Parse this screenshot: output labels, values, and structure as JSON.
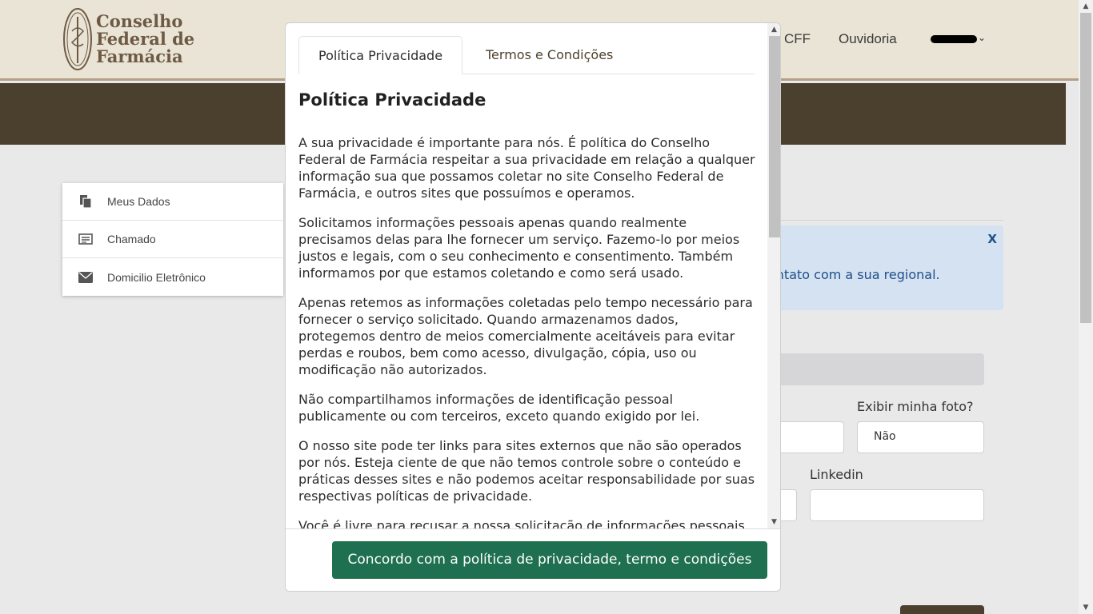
{
  "header": {
    "logo": {
      "line1": "Conselho",
      "line2": "Federal de",
      "line3": "Farmácia"
    },
    "nav": {
      "cff": "CFF",
      "ouvidoria": "Ouvidoria"
    }
  },
  "sidebar": {
    "items": [
      {
        "label": "Meus Dados",
        "icon": "documents-icon"
      },
      {
        "label": "Chamado",
        "icon": "card-list-icon"
      },
      {
        "label": "Domicilio Eletrônico",
        "icon": "envelope-icon"
      }
    ]
  },
  "page": {
    "alert_text": "ontato com a sua regional.",
    "alert_close": "X",
    "label_foto": "Exibir minha foto?",
    "foto_value": "Não",
    "label_linkedin": "Linkedin"
  },
  "modal": {
    "tabs": [
      {
        "label": "Política Privacidade"
      },
      {
        "label": "Termos e Condições"
      }
    ],
    "heading": "Política Privacidade",
    "paragraphs": [
      "A sua privacidade é importante para nós. É política do Conselho Federal de Farmácia respeitar a sua privacidade em relação a qualquer informação sua que possamos coletar no site Conselho Federal de Farmácia, e outros sites que possuímos e operamos.",
      "Solicitamos informações pessoais apenas quando realmente precisamos delas para lhe fornecer um serviço. Fazemo-lo por meios justos e legais, com o seu conhecimento e consentimento. Também informamos por que estamos coletando e como será usado.",
      "Apenas retemos as informações coletadas pelo tempo necessário para fornecer o serviço solicitado. Quando armazenamos dados, protegemos dentro de meios comercialmente aceitáveis para evitar perdas e roubos, bem como acesso, divulgação, cópia, uso ou modificação não autorizados.",
      "Não compartilhamos informações de identificação pessoal publicamente ou com terceiros, exceto quando exigido por lei.",
      "O nosso site pode ter links para sites externos que não são operados por nós. Esteja ciente de que não temos controle sobre o conteúdo e práticas desses sites e não podemos aceitar responsabilidade por suas respectivas políticas de privacidade.",
      "Você é livre para recusar a nossa solicitação de informações pessoais,"
    ],
    "agree_button": "Concordo com a política de privacidade, termo e condições"
  },
  "colors": {
    "header_bg": "#e9e4d5",
    "banner_bg": "#4b3f2e",
    "button_green": "#1f7050",
    "logo_brown": "#6e5a44"
  }
}
